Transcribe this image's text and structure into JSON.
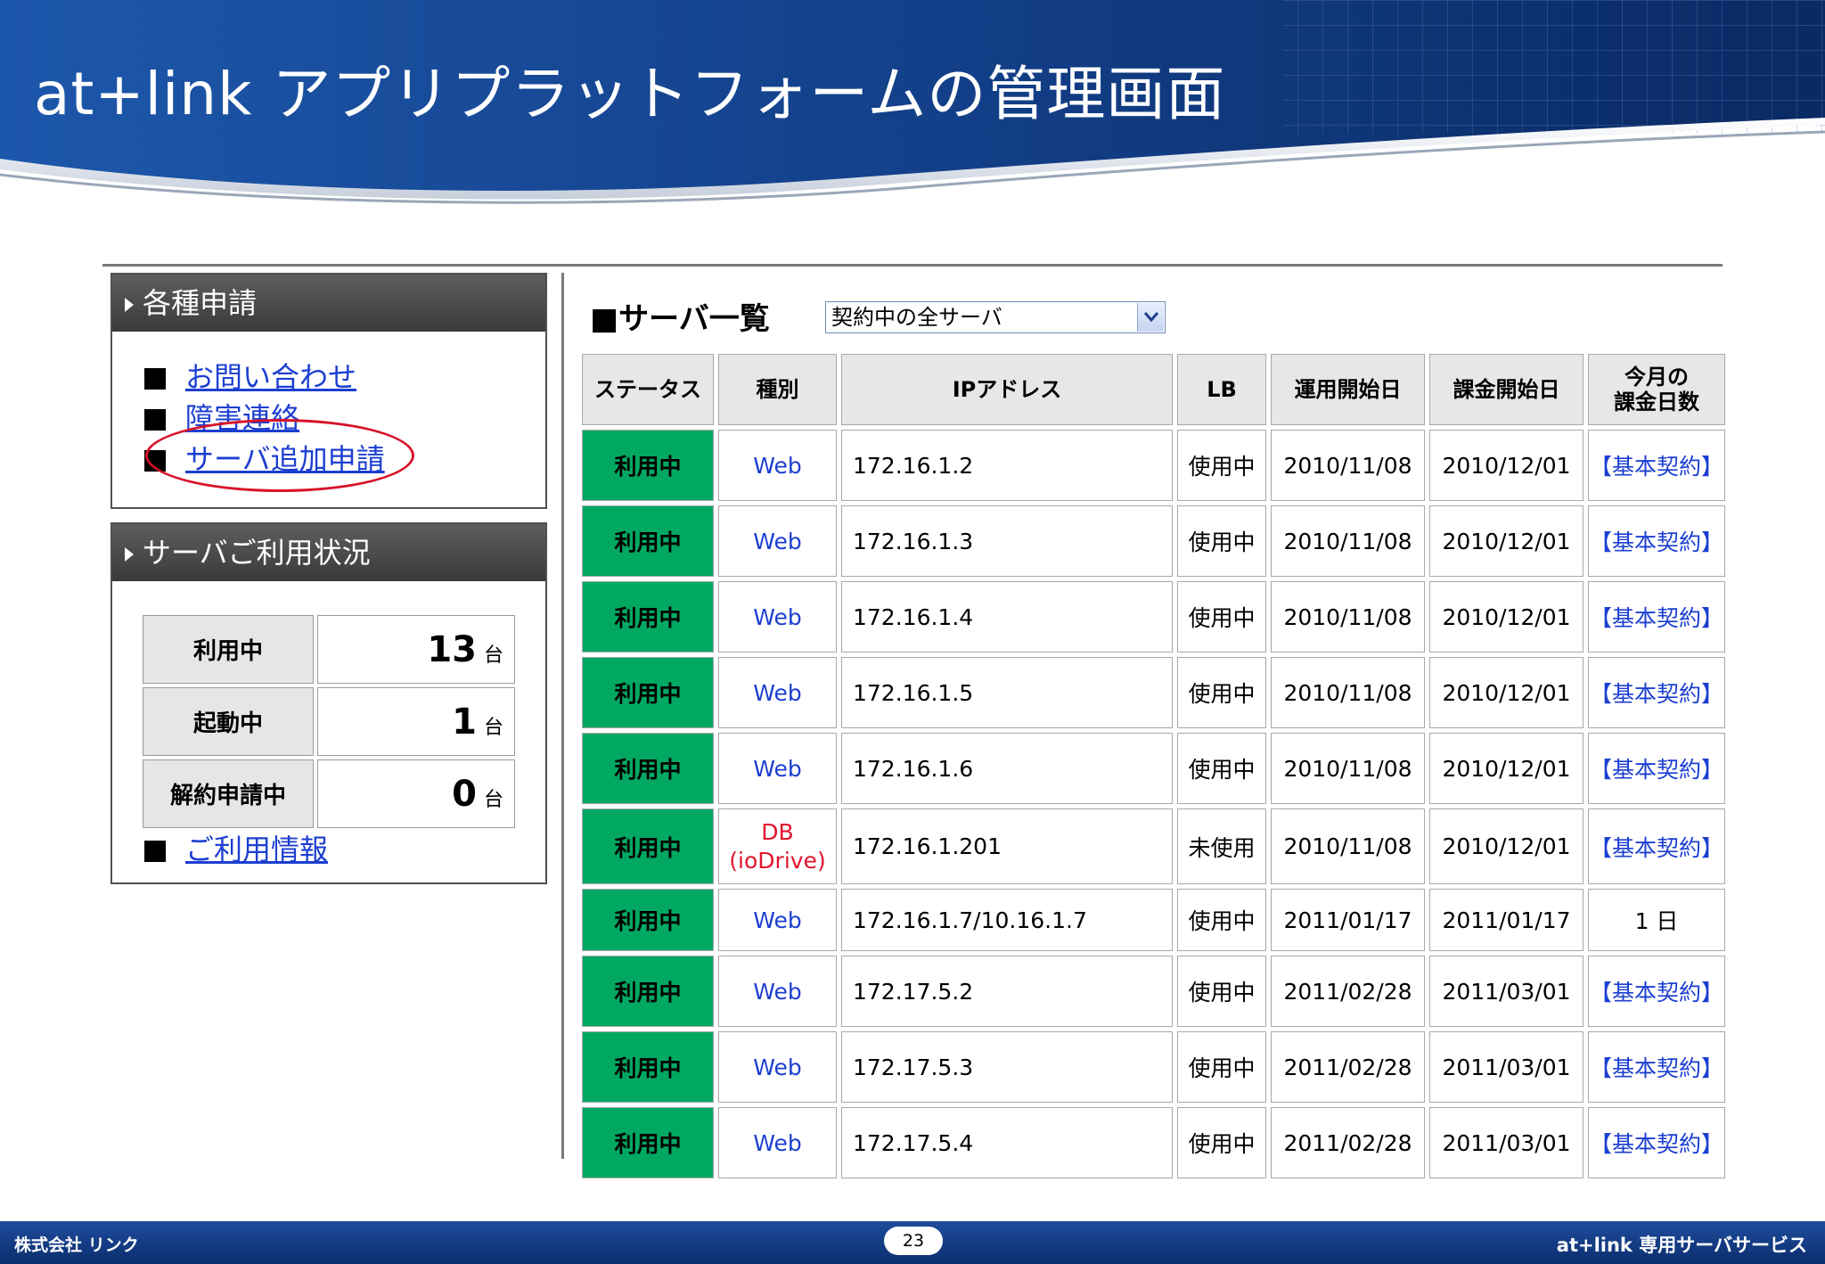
{
  "slide": {
    "title": "at+link アプリプラットフォームの管理画面",
    "company": "株式会社 リンク",
    "page_number": "23",
    "service_name": "at+link 専用サーバサービス"
  },
  "applications_panel": {
    "title": "各種申請",
    "items": [
      {
        "label": "お問い合わせ"
      },
      {
        "label": "障害連絡"
      },
      {
        "label": "サーバ追加申請"
      }
    ]
  },
  "usage_panel": {
    "title": "サーバご利用状況",
    "unit": "台",
    "stats": [
      {
        "label": "利用中",
        "value": "13"
      },
      {
        "label": "起動中",
        "value": "1"
      },
      {
        "label": "解約申請中",
        "value": "0"
      }
    ],
    "link_label": "ご利用情報"
  },
  "server_list": {
    "title": "■サーバ一覧",
    "filter_value": "契約中の全サーバ",
    "headers": {
      "status": "ステータス",
      "type": "種別",
      "ip": "IPアドレス",
      "lb": "LB",
      "start": "運用開始日",
      "billing": "課金開始日",
      "days_line1": "今月の",
      "days_line2": "課金日数"
    },
    "rows": [
      {
        "status": "利用中",
        "type": "Web",
        "ip": "172.16.1.2",
        "lb": "使用中",
        "start": "2010/11/08",
        "billing": "2010/12/01",
        "days": "【基本契約】"
      },
      {
        "status": "利用中",
        "type": "Web",
        "ip": "172.16.1.3",
        "lb": "使用中",
        "start": "2010/11/08",
        "billing": "2010/12/01",
        "days": "【基本契約】"
      },
      {
        "status": "利用中",
        "type": "Web",
        "ip": "172.16.1.4",
        "lb": "使用中",
        "start": "2010/11/08",
        "billing": "2010/12/01",
        "days": "【基本契約】"
      },
      {
        "status": "利用中",
        "type": "Web",
        "ip": "172.16.1.5",
        "lb": "使用中",
        "start": "2010/11/08",
        "billing": "2010/12/01",
        "days": "【基本契約】"
      },
      {
        "status": "利用中",
        "type": "Web",
        "ip": "172.16.1.6",
        "lb": "使用中",
        "start": "2010/11/08",
        "billing": "2010/12/01",
        "days": "【基本契約】"
      },
      {
        "status": "利用中",
        "type": "DB",
        "type_sub": "(ioDrive)",
        "ip": "172.16.1.201",
        "lb": "未使用",
        "start": "2010/11/08",
        "billing": "2010/12/01",
        "days": "【基本契約】"
      },
      {
        "status": "利用中",
        "type": "Web",
        "ip": "172.16.1.7/10.16.1.7",
        "lb": "使用中",
        "start": "2011/01/17",
        "billing": "2011/01/17",
        "days": "1 日"
      },
      {
        "status": "利用中",
        "type": "Web",
        "ip": "172.17.5.2",
        "lb": "使用中",
        "start": "2011/02/28",
        "billing": "2011/03/01",
        "days": "【基本契約】"
      },
      {
        "status": "利用中",
        "type": "Web",
        "ip": "172.17.5.3",
        "lb": "使用中",
        "start": "2011/02/28",
        "billing": "2011/03/01",
        "days": "【基本契約】"
      },
      {
        "status": "利用中",
        "type": "Web",
        "ip": "172.17.5.4",
        "lb": "使用中",
        "start": "2011/02/28",
        "billing": "2011/03/01",
        "days": "【基本契約】"
      }
    ]
  },
  "colors": {
    "status_green": "#00a862",
    "link_blue": "#1c3fd1",
    "db_red": "#e0152d",
    "header_blue": "#1a4f9e",
    "annotation_red": "#d8122a"
  }
}
